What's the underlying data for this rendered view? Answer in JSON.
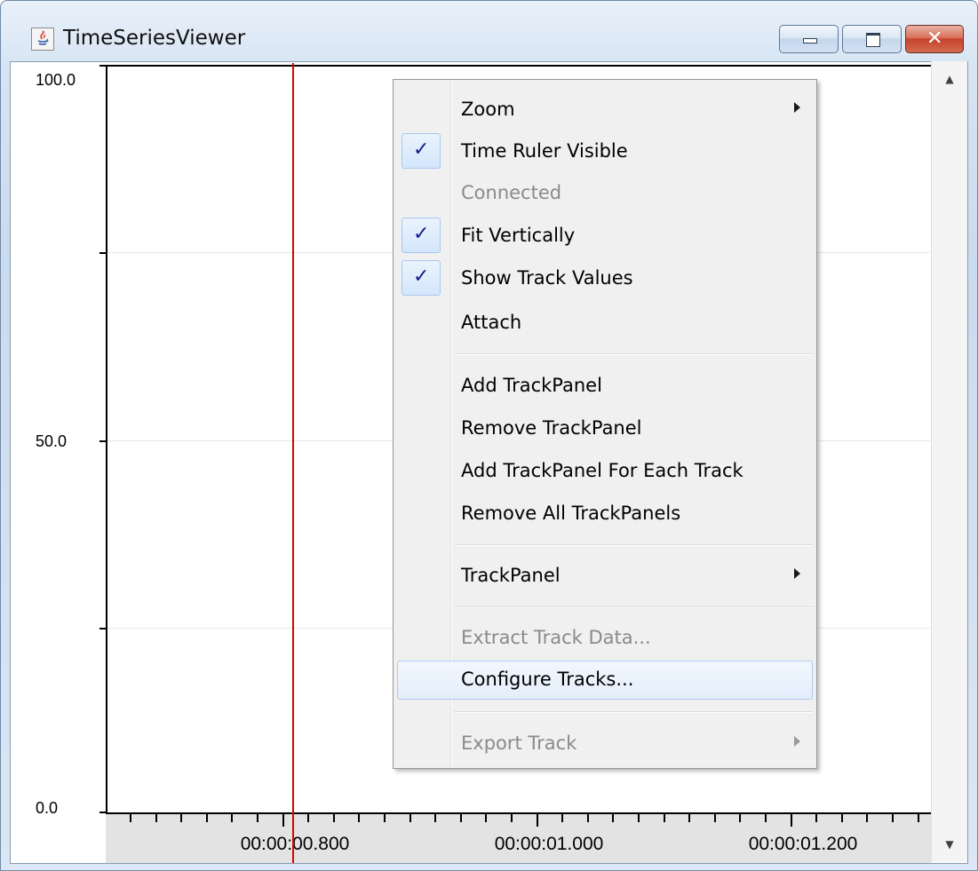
{
  "window": {
    "title": "TimeSeriesViewer",
    "app_icon": "java-icon"
  },
  "plot": {
    "y_axis": {
      "tick_labels": [
        "100.0",
        "50.0",
        "0.0"
      ],
      "range": [
        0,
        100
      ]
    },
    "x_axis": {
      "tick_labels": [
        "00:00:00.800",
        "00:00:01.000",
        "00:00:01.200"
      ]
    },
    "cursor_color": "#e00000"
  },
  "menu": {
    "items": [
      {
        "label": "Zoom",
        "submenu": true,
        "checked": false,
        "enabled": true
      },
      {
        "label": "Time Ruler Visible",
        "submenu": false,
        "checked": true,
        "enabled": true
      },
      {
        "label": "Connected",
        "submenu": false,
        "checked": false,
        "enabled": false
      },
      {
        "label": "Fit Vertically",
        "submenu": false,
        "checked": true,
        "enabled": true
      },
      {
        "label": "Show Track Values",
        "submenu": false,
        "checked": true,
        "enabled": true
      },
      {
        "label": "Attach",
        "submenu": false,
        "checked": false,
        "enabled": true
      },
      {
        "label": "Add TrackPanel",
        "submenu": false,
        "checked": false,
        "enabled": true
      },
      {
        "label": "Remove TrackPanel",
        "submenu": false,
        "checked": false,
        "enabled": true
      },
      {
        "label": "Add TrackPanel For Each Track",
        "submenu": false,
        "checked": false,
        "enabled": true
      },
      {
        "label": "Remove All TrackPanels",
        "submenu": false,
        "checked": false,
        "enabled": true
      },
      {
        "label": "TrackPanel",
        "submenu": true,
        "checked": false,
        "enabled": true
      },
      {
        "label": "Extract Track Data...",
        "submenu": false,
        "checked": false,
        "enabled": false
      },
      {
        "label": "Configure Tracks...",
        "submenu": false,
        "checked": false,
        "enabled": true,
        "highlighted": true
      },
      {
        "label": "Export Track",
        "submenu": true,
        "checked": false,
        "enabled": false
      }
    ],
    "check_glyph": "✓"
  }
}
